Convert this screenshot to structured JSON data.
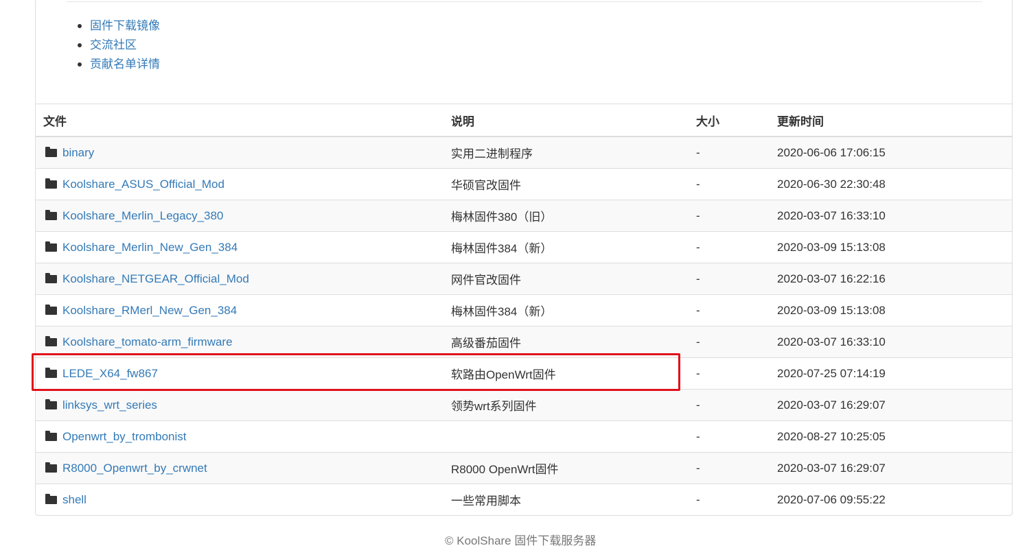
{
  "nav_links": [
    {
      "label": "固件下载镜像"
    },
    {
      "label": "交流社区"
    },
    {
      "label": "贡献名单详情"
    }
  ],
  "table": {
    "headers": {
      "file": "文件",
      "desc": "说明",
      "size": "大小",
      "updated": "更新时间"
    },
    "rows": [
      {
        "name": "binary",
        "desc": "实用二进制程序",
        "size": "-",
        "updated": "2020-06-06 17:06:15"
      },
      {
        "name": "Koolshare_ASUS_Official_Mod",
        "desc": "华硕官改固件",
        "size": "-",
        "updated": "2020-06-30 22:30:48"
      },
      {
        "name": "Koolshare_Merlin_Legacy_380",
        "desc": "梅林固件380（旧）",
        "size": "-",
        "updated": "2020-03-07 16:33:10"
      },
      {
        "name": "Koolshare_Merlin_New_Gen_384",
        "desc": "梅林固件384（新）",
        "size": "-",
        "updated": "2020-03-09 15:13:08"
      },
      {
        "name": "Koolshare_NETGEAR_Official_Mod",
        "desc": "网件官改固件",
        "size": "-",
        "updated": "2020-03-07 16:22:16"
      },
      {
        "name": "Koolshare_RMerl_New_Gen_384",
        "desc": "梅林固件384（新）",
        "size": "-",
        "updated": "2020-03-09 15:13:08"
      },
      {
        "name": "Koolshare_tomato-arm_firmware",
        "desc": "高级番茄固件",
        "size": "-",
        "updated": "2020-03-07 16:33:10"
      },
      {
        "name": "LEDE_X64_fw867",
        "desc": "软路由OpenWrt固件",
        "size": "-",
        "updated": "2020-07-25 07:14:19"
      },
      {
        "name": "linksys_wrt_series",
        "desc": "领势wrt系列固件",
        "size": "-",
        "updated": "2020-03-07 16:29:07"
      },
      {
        "name": "Openwrt_by_trombonist",
        "desc": "",
        "size": "-",
        "updated": "2020-08-27 10:25:05"
      },
      {
        "name": "R8000_Openwrt_by_crwnet",
        "desc": "R8000 OpenWrt固件",
        "size": "-",
        "updated": "2020-03-07 16:29:07"
      },
      {
        "name": "shell",
        "desc": "一些常用脚本",
        "size": "-",
        "updated": "2020-07-06 09:55:22"
      }
    ]
  },
  "icons": {
    "folder": "folder-icon"
  },
  "colors": {
    "link": "#337ab7",
    "highlight": "#e0101a"
  },
  "footer": {
    "text": "© KoolShare 固件下载服务器"
  }
}
